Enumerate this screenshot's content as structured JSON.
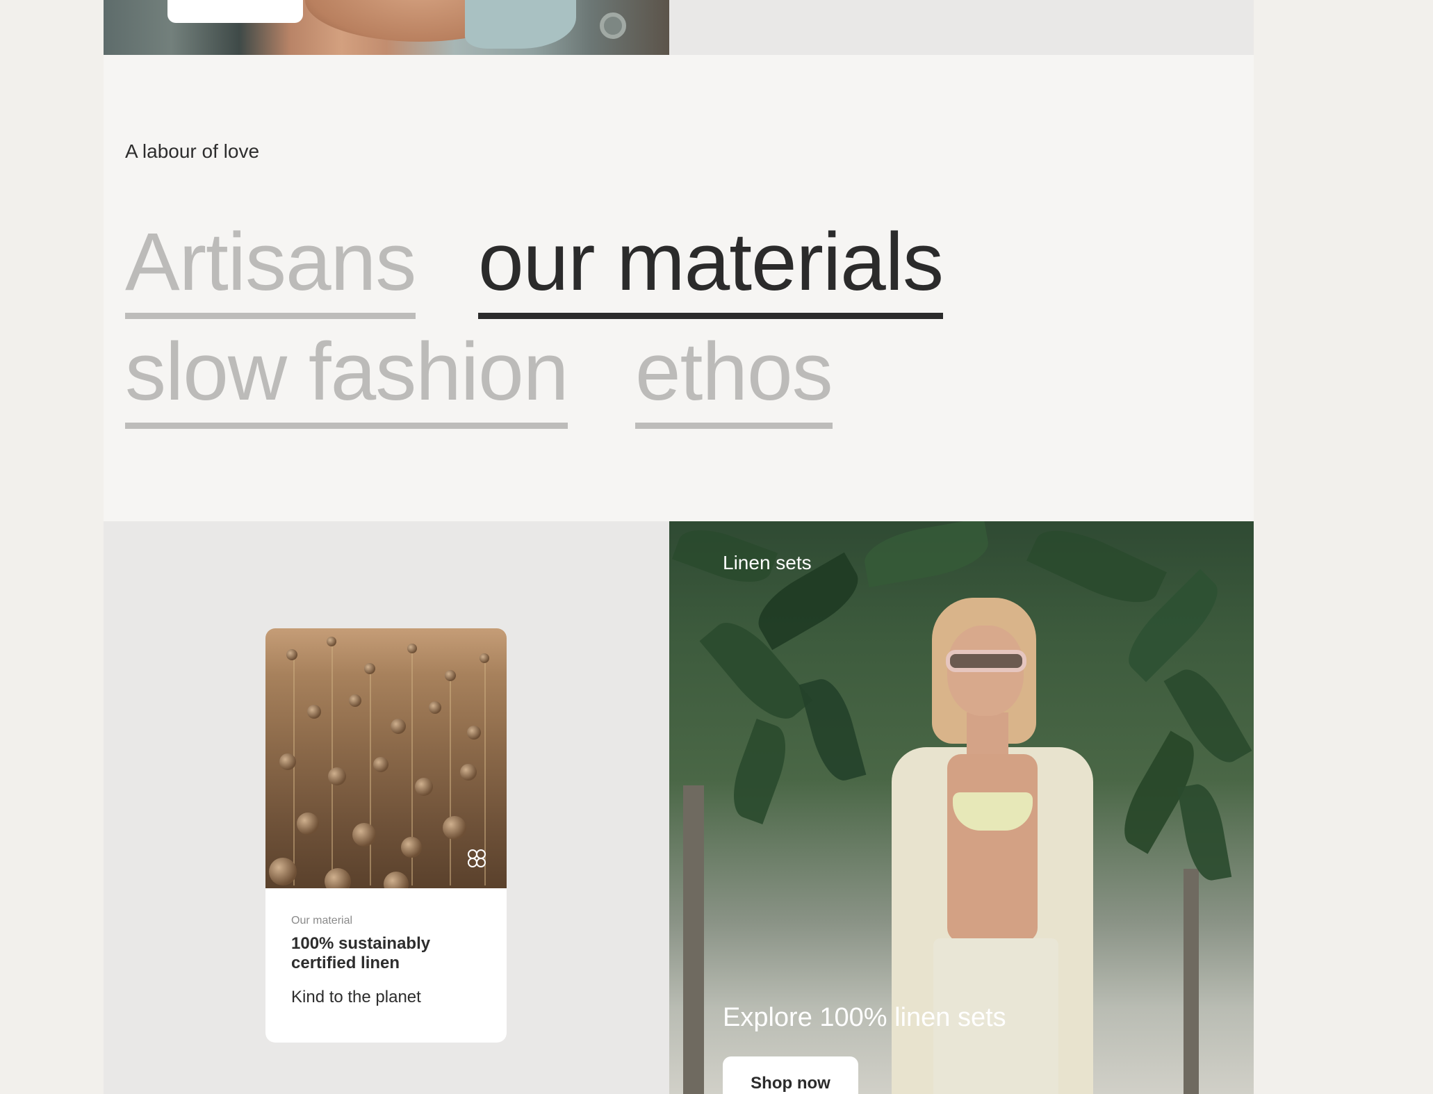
{
  "intro": {
    "eyebrow": "A labour of love"
  },
  "tabs": [
    {
      "label": "Artisans",
      "active": false
    },
    {
      "label": "our materials",
      "active": true
    },
    {
      "label": "slow fashion",
      "active": false
    },
    {
      "label": "ethos",
      "active": false
    }
  ],
  "material_card": {
    "eyebrow": "Our material",
    "title": "100% sustainably certified linen",
    "subtitle": "Kind to the planet",
    "icon": "flower-icon"
  },
  "linen_sets": {
    "label": "Linen sets",
    "title": "Explore 100% linen sets",
    "button_label": "Shop now"
  },
  "colors": {
    "active_tab": "#2b2b2b",
    "inactive_tab": "#bcbbb9",
    "page_background": "#f6f5f3",
    "panel_background": "#e9e8e7"
  }
}
